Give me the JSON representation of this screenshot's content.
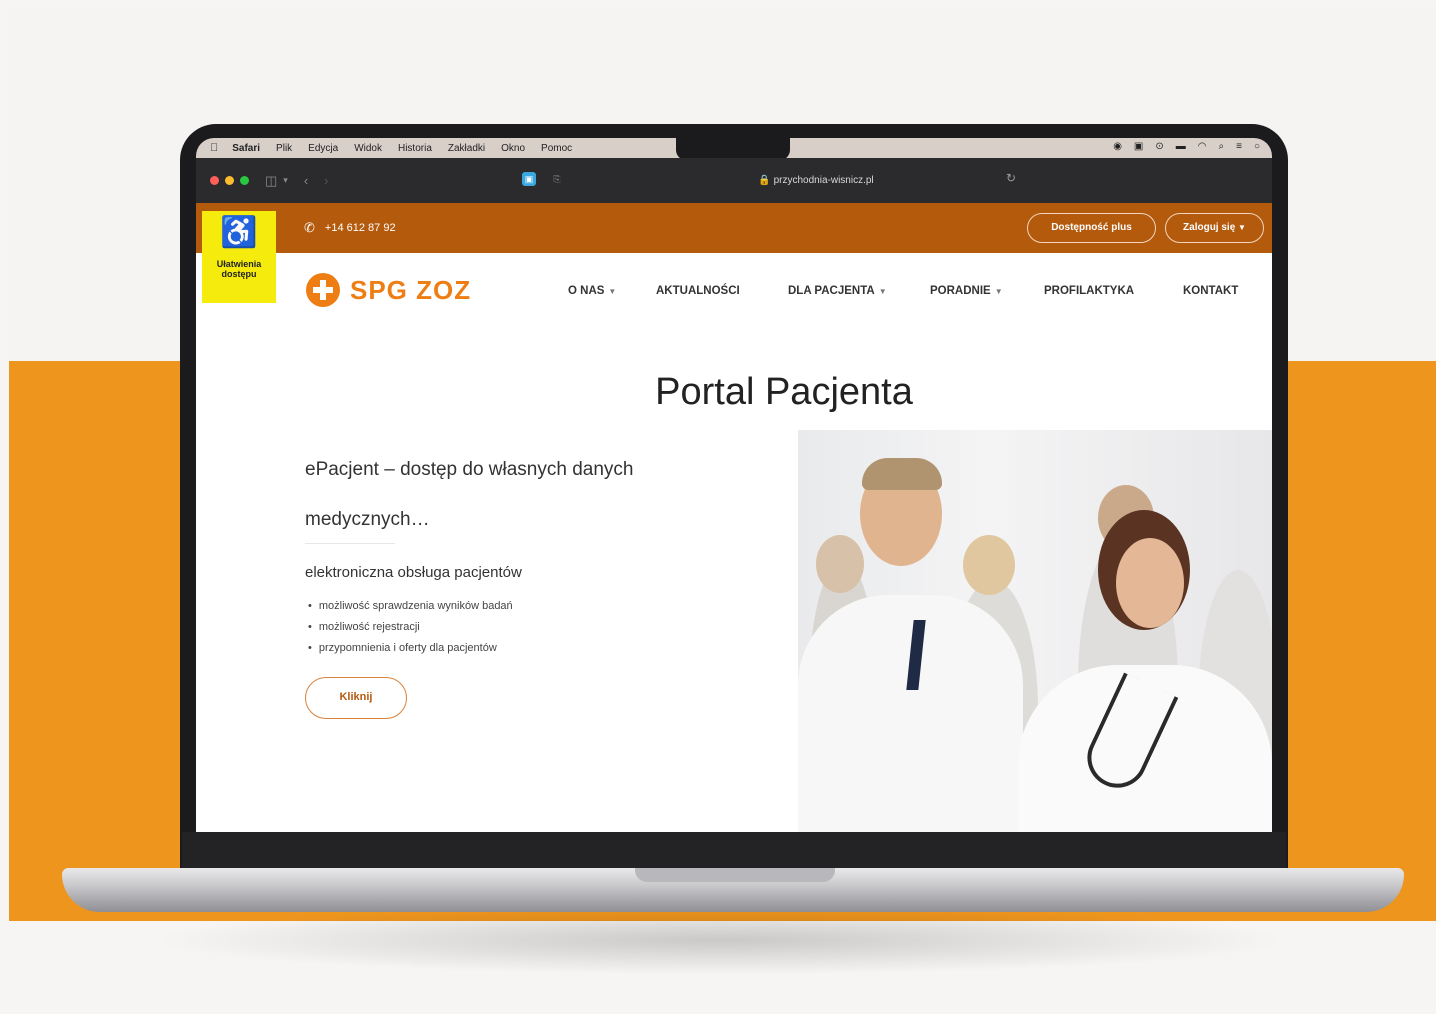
{
  "menubar": {
    "app": "Safari",
    "items": [
      "Plik",
      "Edycja",
      "Widok",
      "Historia",
      "Zakładki",
      "Okno",
      "Pomoc"
    ]
  },
  "browser": {
    "url": "przychodnia-wisnicz.pl"
  },
  "site": {
    "phone": "+14 612 87 92",
    "accessibility_label_line1": "Ułatwienia",
    "accessibility_label_line2": "dostępu",
    "access_plus": "Dostępność plus",
    "login": "Zaloguj się",
    "logo_text": "SPG ZOZ",
    "nav": [
      {
        "label": "O NAS"
      },
      {
        "label": "AKTUALNOŚCI"
      },
      {
        "label": "DLA PACJENTA"
      },
      {
        "label": "PORADNIE"
      },
      {
        "label": "PROFILAKTYKA"
      },
      {
        "label": "KONTAKT"
      }
    ],
    "title": "Portal Pacjenta",
    "lead": "ePacjent –  dostęp do własnych danych medycznych…",
    "subheading": "elektroniczna obsługa pacjentów",
    "bullets": [
      "możliwość sprawdzenia wyników badań",
      "możliwość rejestracji",
      "przypomnienia i oferty dla pacjentów"
    ],
    "cta": "Kliknij"
  },
  "colors": {
    "brand_orange": "#ee7e14",
    "topbar": "#b45a0c",
    "background_band": "#ee951e",
    "access_yellow": "#f5eb0d"
  }
}
